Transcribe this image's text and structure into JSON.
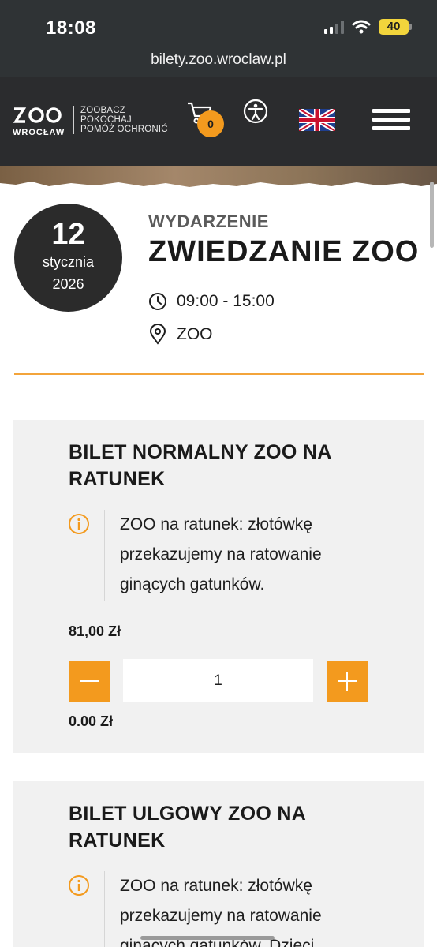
{
  "status_bar": {
    "time": "18:08",
    "battery": "40",
    "signal_bars_active": 2,
    "signal_bars_total": 4
  },
  "browser": {
    "url": "bilety.zoo.wroclaw.pl"
  },
  "header": {
    "logo_text": "WROCŁAW",
    "tagline": [
      "ZOOBACZ",
      "POKOCHAJ",
      "POMÓŻ OCHRONIĆ"
    ],
    "cart_icon": "cart-icon",
    "cart_count": "0",
    "accessibility_icon": "accessibility-icon",
    "language_icon": "uk-flag-icon",
    "menu_icon": "hamburger-menu-icon"
  },
  "event": {
    "day": "12",
    "month": "stycznia",
    "year": "2026",
    "kicker": "WYDARZENIE",
    "title": "ZWIEDZANIE ZOO",
    "time": "09:00 - 15:00",
    "place": "ZOO"
  },
  "tickets": [
    {
      "title": "BILET NORMALNY ZOO NA RATUNEK",
      "info": "ZOO na ratunek: złotówkę przekazujemy na ratowanie ginących gatunków.",
      "price": "81,00 Zł",
      "quantity": "1",
      "subtotal": "0.00 Zł"
    },
    {
      "title": "BILET ULGOWY ZOO NA RATUNEK",
      "info": "ZOO na ratunek: złotówkę przekazujemy na ratowanie ginących gatunków. Dzieci"
    }
  ],
  "colors": {
    "accent": "#f39a1e",
    "dark": "#2b2c2e",
    "card_bg": "#f1f1f1"
  }
}
